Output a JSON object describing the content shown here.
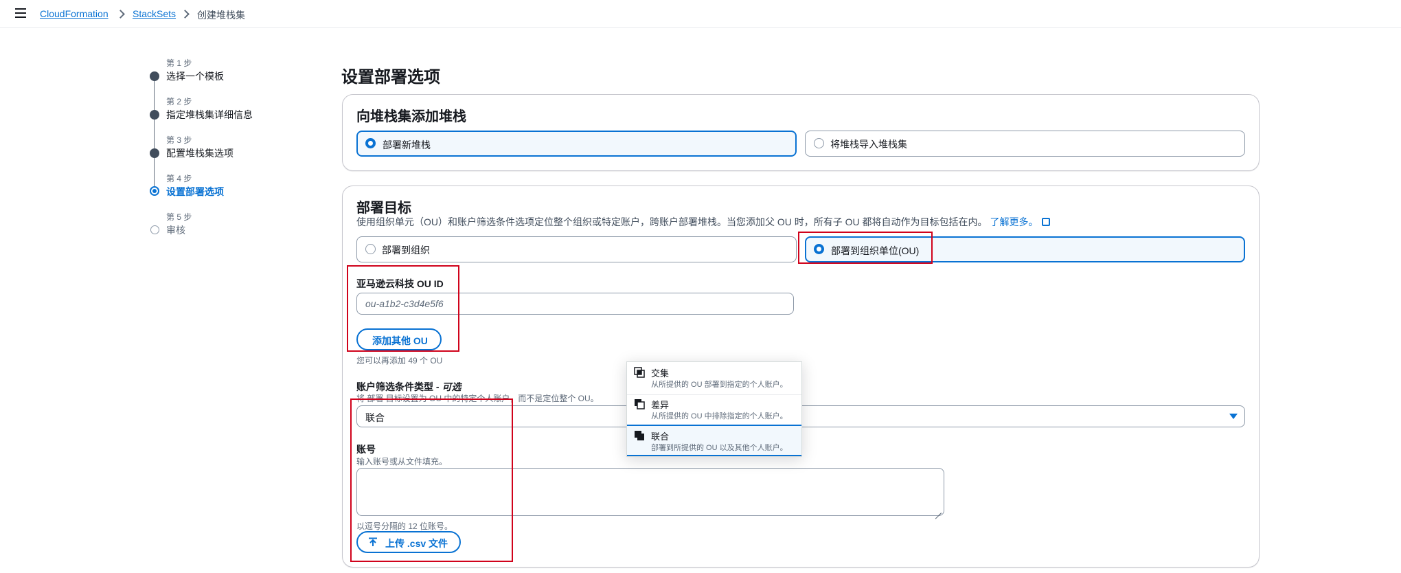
{
  "breadcrumbs": [
    "CloudFormation",
    "StackSets",
    "创建堆栈集"
  ],
  "steps": [
    {
      "num": "第 1 步",
      "title": "选择一个模板"
    },
    {
      "num": "第 2 步",
      "title": "指定堆栈集详细信息"
    },
    {
      "num": "第 3 步",
      "title": "配置堆栈集选项"
    },
    {
      "num": "第 4 步",
      "title": "设置部署选项"
    },
    {
      "num": "第 5 步",
      "title": "审核"
    }
  ],
  "page_title": "设置部署选项",
  "add_stacks": {
    "heading": "向堆栈集添加堆栈",
    "option_new": "部署新堆栈",
    "option_import": "将堆栈导入堆栈集"
  },
  "targets": {
    "heading": "部署目标",
    "description": "使用组织单元（OU）和账户筛选条件选项定位整个组织或特定账户，跨账户部署堆栈。当您添加父 OU 时，所有子 OU 都将自动作为目标包括在内。",
    "learn_more": "了解更多。",
    "option_org": "部署到组织",
    "option_ou": "部署到组织单位(OU)",
    "ou_label": "亚马逊云科技 OU ID",
    "ou_placeholder": "ou-a1b2-c3d4e5f6",
    "add_ou_button": "添加其他 OU",
    "ou_remaining": "您可以再添加 49 个 OU",
    "filter_label": "账户筛选条件类型",
    "filter_optional": "- 可选",
    "filter_help": "将 部署 目标设置为 OU 中的特定个人账户，而不是定位整个 OU。",
    "filter_value": "联合",
    "account_label": "账号",
    "account_help": "输入账号或从文件填充。",
    "account_constraint": "以逗号分隔的 12 位账号。",
    "upload_button": "上传 .csv 文件"
  },
  "filter_options": [
    {
      "title": "交集",
      "desc": "从所提供的 OU 部署到指定的个人账户。"
    },
    {
      "title": "差异",
      "desc": "从所提供的 OU 中排除指定的个人账户。"
    },
    {
      "title": "联合",
      "desc": "部署到所提供的 OU 以及其他个人账户。"
    }
  ],
  "colors": {
    "accent": "#0972d3",
    "highlight_box": "#d0021b"
  }
}
